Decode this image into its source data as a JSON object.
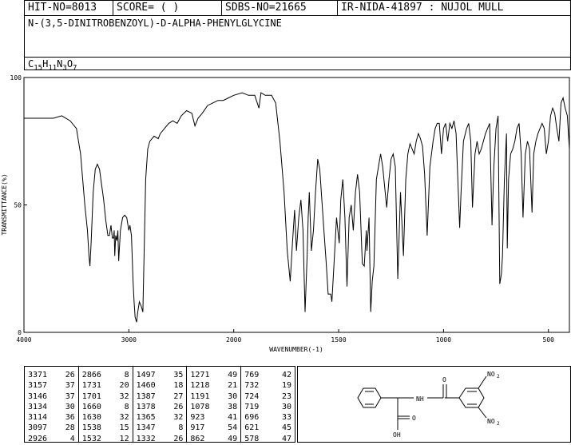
{
  "header": {
    "hit_no": "HIT-NO=8013",
    "score": "SCORE=  (   )",
    "sdbs_no": "SDBS-NO=21665",
    "ir_label": "IR-NIDA-41897 : NUJOL MULL",
    "compound_name": "N-(3,5-DINITROBENZOYL)-D-ALPHA-PHENYLGLYCINE",
    "formula_parts": [
      "C",
      "15",
      "H",
      "11",
      "N",
      "3",
      "O",
      "7"
    ]
  },
  "chart_data": {
    "type": "line",
    "xlabel": "WAVENUMBER(-1)",
    "ylabel": "TRANSMITTANCE(%)",
    "xlim": [
      4000,
      400
    ],
    "ylim": [
      0,
      100
    ],
    "x_ticks": [
      4000,
      3000,
      2000,
      1500,
      1000,
      500
    ],
    "x_tick_labels": [
      "4000",
      "3000",
      "2000",
      "1500",
      "1000",
      "500"
    ],
    "y_ticks": [
      0,
      50,
      100
    ],
    "y_tick_labels": [
      "0",
      "50",
      "100"
    ],
    "series": [
      {
        "points": [
          [
            4000,
            84
          ],
          [
            3900,
            84
          ],
          [
            3800,
            84
          ],
          [
            3720,
            84
          ],
          [
            3640,
            85
          ],
          [
            3560,
            83
          ],
          [
            3500,
            80
          ],
          [
            3460,
            70
          ],
          [
            3420,
            50
          ],
          [
            3395,
            40
          ],
          [
            3380,
            30
          ],
          [
            3371,
            26
          ],
          [
            3360,
            35
          ],
          [
            3340,
            55
          ],
          [
            3320,
            64
          ],
          [
            3300,
            66
          ],
          [
            3280,
            64
          ],
          [
            3260,
            58
          ],
          [
            3240,
            52
          ],
          [
            3220,
            44
          ],
          [
            3200,
            38
          ],
          [
            3185,
            38
          ],
          [
            3170,
            42
          ],
          [
            3157,
            37
          ],
          [
            3146,
            37
          ],
          [
            3140,
            40
          ],
          [
            3134,
            30
          ],
          [
            3125,
            38
          ],
          [
            3114,
            36
          ],
          [
            3105,
            40
          ],
          [
            3097,
            28
          ],
          [
            3080,
            40
          ],
          [
            3060,
            45
          ],
          [
            3040,
            46
          ],
          [
            3020,
            45
          ],
          [
            3000,
            40
          ],
          [
            2990,
            42
          ],
          [
            2975,
            38
          ],
          [
            2960,
            20
          ],
          [
            2950,
            12
          ],
          [
            2940,
            6
          ],
          [
            2926,
            4
          ],
          [
            2915,
            8
          ],
          [
            2900,
            12
          ],
          [
            2880,
            10
          ],
          [
            2866,
            8
          ],
          [
            2855,
            30
          ],
          [
            2840,
            60
          ],
          [
            2820,
            72
          ],
          [
            2800,
            75
          ],
          [
            2760,
            77
          ],
          [
            2720,
            76
          ],
          [
            2700,
            78
          ],
          [
            2660,
            80
          ],
          [
            2620,
            82
          ],
          [
            2580,
            83
          ],
          [
            2540,
            82
          ],
          [
            2500,
            85
          ],
          [
            2450,
            87
          ],
          [
            2400,
            86
          ],
          [
            2370,
            81
          ],
          [
            2340,
            84
          ],
          [
            2300,
            86
          ],
          [
            2250,
            89
          ],
          [
            2200,
            90
          ],
          [
            2150,
            91
          ],
          [
            2100,
            91
          ],
          [
            2050,
            92
          ],
          [
            2000,
            93
          ],
          [
            1960,
            94
          ],
          [
            1930,
            93
          ],
          [
            1900,
            93
          ],
          [
            1880,
            88
          ],
          [
            1870,
            94
          ],
          [
            1850,
            93
          ],
          [
            1820,
            93
          ],
          [
            1800,
            90
          ],
          [
            1780,
            75
          ],
          [
            1760,
            55
          ],
          [
            1745,
            32
          ],
          [
            1731,
            20
          ],
          [
            1720,
            35
          ],
          [
            1710,
            48
          ],
          [
            1701,
            32
          ],
          [
            1690,
            45
          ],
          [
            1680,
            52
          ],
          [
            1670,
            40
          ],
          [
            1660,
            8
          ],
          [
            1650,
            30
          ],
          [
            1645,
            45
          ],
          [
            1640,
            55
          ],
          [
            1630,
            32
          ],
          [
            1620,
            40
          ],
          [
            1610,
            55
          ],
          [
            1600,
            68
          ],
          [
            1590,
            64
          ],
          [
            1580,
            52
          ],
          [
            1570,
            40
          ],
          [
            1560,
            28
          ],
          [
            1550,
            15
          ],
          [
            1538,
            15
          ],
          [
            1532,
            12
          ],
          [
            1520,
            30
          ],
          [
            1510,
            45
          ],
          [
            1497,
            35
          ],
          [
            1490,
            52
          ],
          [
            1480,
            60
          ],
          [
            1470,
            45
          ],
          [
            1460,
            18
          ],
          [
            1450,
            45
          ],
          [
            1440,
            50
          ],
          [
            1430,
            40
          ],
          [
            1420,
            55
          ],
          [
            1410,
            62
          ],
          [
            1400,
            55
          ],
          [
            1387,
            27
          ],
          [
            1378,
            26
          ],
          [
            1368,
            40
          ],
          [
            1365,
            32
          ],
          [
            1355,
            45
          ],
          [
            1347,
            8
          ],
          [
            1340,
            20
          ],
          [
            1332,
            26
          ],
          [
            1320,
            60
          ],
          [
            1310,
            65
          ],
          [
            1300,
            70
          ],
          [
            1290,
            65
          ],
          [
            1271,
            49
          ],
          [
            1260,
            60
          ],
          [
            1250,
            68
          ],
          [
            1240,
            70
          ],
          [
            1230,
            65
          ],
          [
            1218,
            21
          ],
          [
            1205,
            55
          ],
          [
            1191,
            30
          ],
          [
            1180,
            60
          ],
          [
            1170,
            70
          ],
          [
            1160,
            74
          ],
          [
            1150,
            72
          ],
          [
            1140,
            70
          ],
          [
            1130,
            75
          ],
          [
            1120,
            78
          ],
          [
            1110,
            76
          ],
          [
            1100,
            73
          ],
          [
            1090,
            62
          ],
          [
            1078,
            38
          ],
          [
            1065,
            65
          ],
          [
            1050,
            75
          ],
          [
            1040,
            80
          ],
          [
            1030,
            82
          ],
          [
            1020,
            82
          ],
          [
            1010,
            70
          ],
          [
            1000,
            80
          ],
          [
            990,
            82
          ],
          [
            980,
            75
          ],
          [
            970,
            82
          ],
          [
            960,
            80
          ],
          [
            950,
            83
          ],
          [
            940,
            78
          ],
          [
            923,
            41
          ],
          [
            917,
            54
          ],
          [
            905,
            75
          ],
          [
            890,
            80
          ],
          [
            880,
            82
          ],
          [
            870,
            75
          ],
          [
            862,
            49
          ],
          [
            850,
            70
          ],
          [
            840,
            75
          ],
          [
            830,
            70
          ],
          [
            820,
            72
          ],
          [
            810,
            75
          ],
          [
            800,
            78
          ],
          [
            790,
            80
          ],
          [
            780,
            82
          ],
          [
            769,
            42
          ],
          [
            760,
            65
          ],
          [
            750,
            80
          ],
          [
            740,
            85
          ],
          [
            732,
            19
          ],
          [
            724,
            23
          ],
          [
            719,
            30
          ],
          [
            710,
            60
          ],
          [
            700,
            78
          ],
          [
            696,
            33
          ],
          [
            690,
            60
          ],
          [
            680,
            70
          ],
          [
            670,
            72
          ],
          [
            660,
            75
          ],
          [
            650,
            80
          ],
          [
            640,
            82
          ],
          [
            630,
            70
          ],
          [
            621,
            45
          ],
          [
            610,
            70
          ],
          [
            600,
            75
          ],
          [
            590,
            72
          ],
          [
            578,
            47
          ],
          [
            570,
            70
          ],
          [
            560,
            75
          ],
          [
            550,
            78
          ],
          [
            540,
            80
          ],
          [
            530,
            82
          ],
          [
            520,
            80
          ],
          [
            510,
            70
          ],
          [
            500,
            75
          ],
          [
            490,
            85
          ],
          [
            480,
            88
          ],
          [
            470,
            86
          ],
          [
            460,
            80
          ],
          [
            450,
            75
          ],
          [
            440,
            90
          ],
          [
            430,
            92
          ],
          [
            420,
            88
          ],
          [
            410,
            85
          ],
          [
            400,
            72
          ]
        ]
      }
    ]
  },
  "peak_table": {
    "columns": [
      [
        [
          "3371",
          "26"
        ],
        [
          "3157",
          "37"
        ],
        [
          "3146",
          "37"
        ],
        [
          "3134",
          "30"
        ],
        [
          "3114",
          "36"
        ],
        [
          "3097",
          "28"
        ],
        [
          "2926",
          "4"
        ]
      ],
      [
        [
          "2866",
          "8"
        ],
        [
          "1731",
          "20"
        ],
        [
          "1701",
          "32"
        ],
        [
          "1660",
          "8"
        ],
        [
          "1630",
          "32"
        ],
        [
          "1538",
          "15"
        ],
        [
          "1532",
          "12"
        ]
      ],
      [
        [
          "1497",
          "35"
        ],
        [
          "1460",
          "18"
        ],
        [
          "1387",
          "27"
        ],
        [
          "1378",
          "26"
        ],
        [
          "1365",
          "32"
        ],
        [
          "1347",
          "8"
        ],
        [
          "1332",
          "26"
        ]
      ],
      [
        [
          "1271",
          "49"
        ],
        [
          "1218",
          "21"
        ],
        [
          "1191",
          "30"
        ],
        [
          "1078",
          "38"
        ],
        [
          "923",
          "41"
        ],
        [
          "917",
          "54"
        ],
        [
          "862",
          "49"
        ]
      ],
      [
        [
          "769",
          "42"
        ],
        [
          "732",
          "19"
        ],
        [
          "724",
          "23"
        ],
        [
          "719",
          "30"
        ],
        [
          "696",
          "33"
        ],
        [
          "621",
          "45"
        ],
        [
          "578",
          "47"
        ]
      ]
    ]
  },
  "structure": {
    "labels": {
      "nh": "NH",
      "o_top": "O",
      "o_bottom": "O",
      "oh": "OH",
      "no2_top": "NO",
      "no2_top_sub": "2",
      "no2_bottom": "NO",
      "no2_bottom_sub": "2"
    }
  }
}
